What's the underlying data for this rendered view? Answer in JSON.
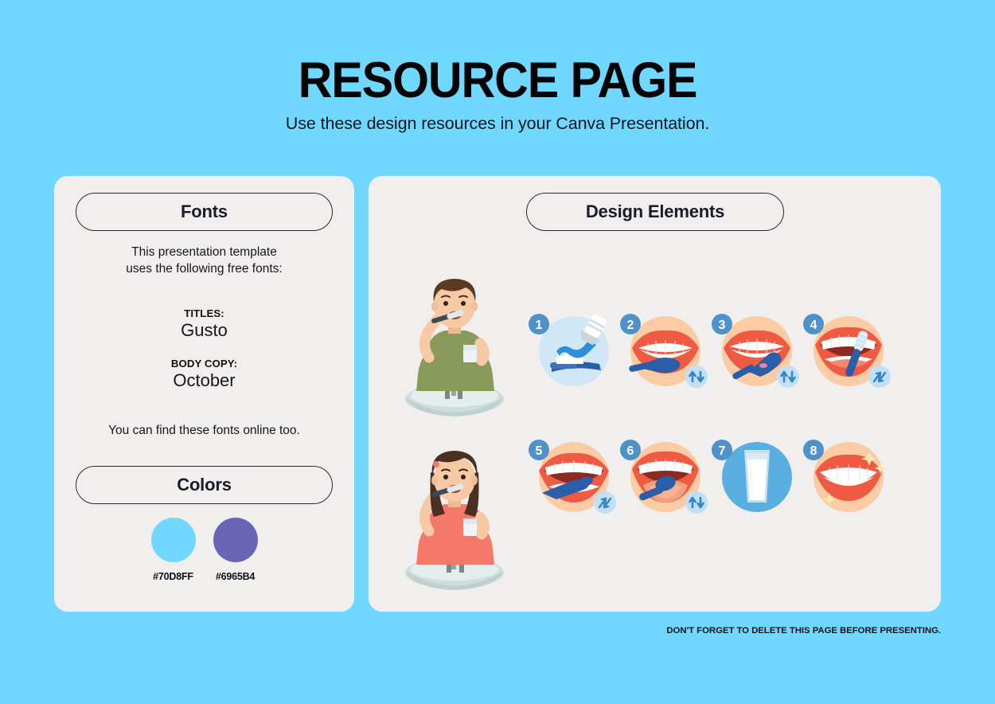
{
  "header": {
    "title": "RESOURCE PAGE",
    "subtitle": "Use these design resources in your Canva Presentation."
  },
  "fonts_panel": {
    "pill_label": "Fonts",
    "description": "This presentation template\nuses the following free fonts:",
    "description_line1": "This presentation template",
    "description_line2": "uses the following free fonts:",
    "titles_role": "TITLES:",
    "titles_font": "Gusto",
    "body_role": "BODY COPY:",
    "body_font": "October",
    "note": "You can find these fonts online too."
  },
  "colors_panel": {
    "pill_label": "Colors",
    "swatches": [
      {
        "hex": "#70D8FF",
        "name": "sky-blue"
      },
      {
        "hex": "#6965B4",
        "name": "purple"
      }
    ]
  },
  "design_panel": {
    "pill_label": "Design Elements",
    "people": [
      {
        "name": "boy-brushing-teeth",
        "shirt": "#8a9a5b",
        "hair": "#5c3a21",
        "skin": "#f7c9a4"
      },
      {
        "name": "girl-brushing-teeth",
        "shirt": "#f4796b",
        "hair": "#4a2f22",
        "skin": "#f7c9a4"
      }
    ],
    "icons": [
      {
        "number": "1",
        "name": "toothpaste-on-brush",
        "circle": "#cfe7f7",
        "badge": ""
      },
      {
        "number": "2",
        "name": "brush-front-teeth",
        "circle": "#fbcba4",
        "badge": "up-down-arrows"
      },
      {
        "number": "3",
        "name": "brush-outer-surface",
        "circle": "#fbcba4",
        "badge": "up-down-arrows"
      },
      {
        "number": "4",
        "name": "brush-inner-surface",
        "circle": "#fbcba4",
        "badge": "diagonal-arrows"
      },
      {
        "number": "5",
        "name": "brush-chewing-surface",
        "circle": "#fbcba4",
        "badge": "diagonal-arrows"
      },
      {
        "number": "6",
        "name": "brush-tongue",
        "circle": "#fbcba4",
        "badge": "up-down-arrows"
      },
      {
        "number": "7",
        "name": "glass-of-water",
        "circle": "#5aaee0",
        "badge": ""
      },
      {
        "number": "8",
        "name": "clean-sparkling-teeth",
        "circle": "#fbcba4",
        "badge": ""
      }
    ]
  },
  "footer": {
    "note": "DON'T FORGET TO DELETE THIS PAGE BEFORE PRESENTING."
  },
  "theme": {
    "background": "#70D8FF",
    "panel": "#F0EFEE",
    "ink": "#1B1C2B",
    "badge_blue": "#4e92c9",
    "brush_blue": "#2a5ea8",
    "lip_red": "#ef5a43"
  }
}
